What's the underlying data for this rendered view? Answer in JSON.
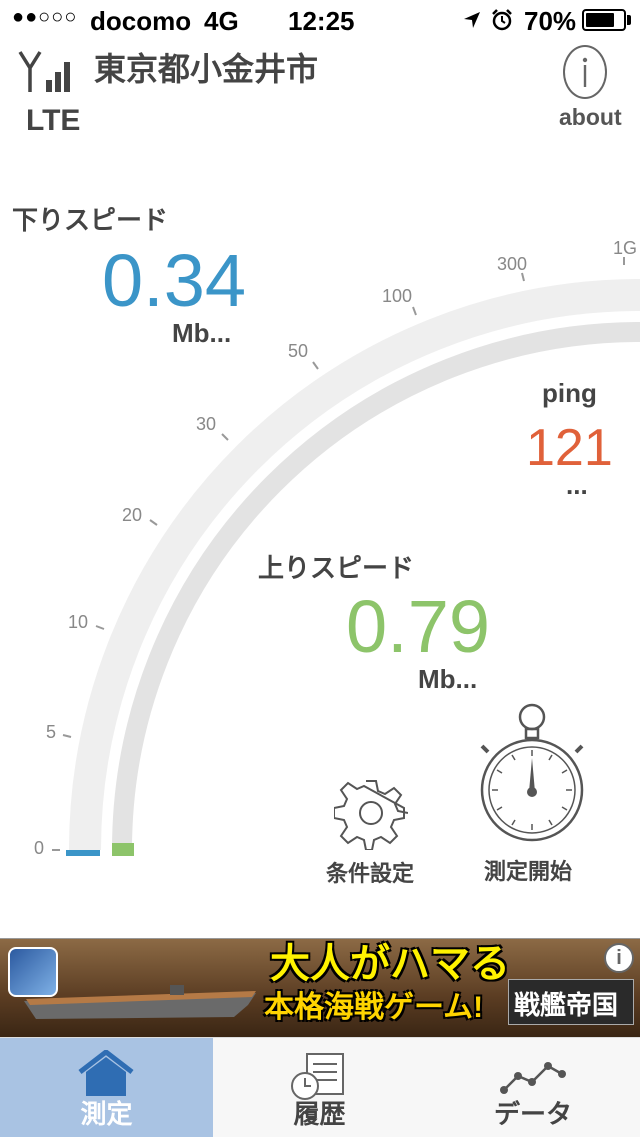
{
  "status_bar": {
    "signal_dots": "●●○○○",
    "carrier": "docomo",
    "network": "4G",
    "time": "12:25",
    "battery": "70%"
  },
  "header": {
    "location": "東京都小金井市",
    "connection_type": "LTE",
    "about_label": "about"
  },
  "download": {
    "label": "下りスピード",
    "value": "0.34",
    "unit": "Mb...",
    "color": "#3b95c8"
  },
  "ping": {
    "label": "ping",
    "value": "121",
    "unit": "...",
    "color": "#e0613a"
  },
  "upload": {
    "label": "上りスピード",
    "value": "0.79",
    "unit": "Mb...",
    "color": "#8dc46a"
  },
  "gauge": {
    "ticks": [
      "0",
      "5",
      "10",
      "20",
      "30",
      "50",
      "100",
      "300",
      "1G"
    ]
  },
  "controls": {
    "settings_label": "条件設定",
    "start_label": "測定開始"
  },
  "ad": {
    "title_line1": "大人がハマる",
    "title_line2": "本格海戦ゲーム!",
    "brand": "戦艦帝国",
    "info_icon": "info-icon"
  },
  "tabs": [
    {
      "label": "測定",
      "icon": "home-icon",
      "active": true
    },
    {
      "label": "履歴",
      "icon": "history-icon",
      "active": false
    },
    {
      "label": "データ",
      "icon": "chart-icon",
      "active": false
    }
  ],
  "colors": {
    "tab_active_bg": "#a9c3e3",
    "tab_active_fg": "#ffffff",
    "tab_inactive_fg": "#444444"
  }
}
